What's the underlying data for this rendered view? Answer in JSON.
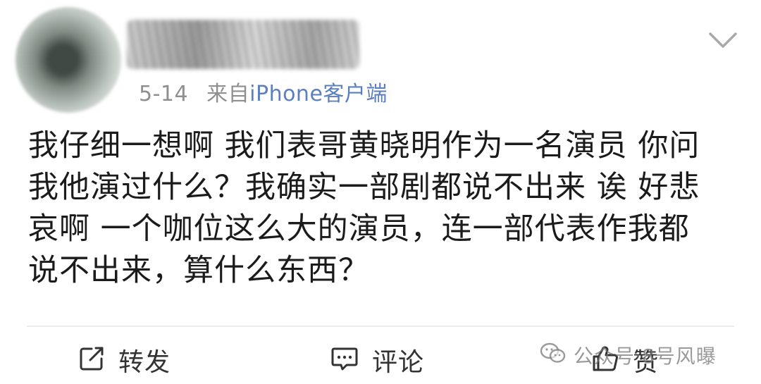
{
  "header": {
    "date": "5-14",
    "source_label": "来自",
    "source_app": "iPhone客户端"
  },
  "post": {
    "lines": [
      "我仔细一想啊 我们表哥黄晓明作为一名演员 你问",
      "我他演过什么？我确实一部剧都说不出来 诶 好悲",
      "哀啊 一个咖位这么大的演员，连一部代表作我都",
      "说不出来，算什么东西？"
    ]
  },
  "actions": {
    "repost_label": "转发",
    "comment_label": "评论",
    "like_label": "赞"
  },
  "watermark": {
    "text": "公众号·8号风曝"
  },
  "icons": {
    "expand": "chevron-down-icon",
    "repost": "share-icon",
    "comment": "comment-icon",
    "like": "thumbs-up-icon",
    "watermark": "wechat-icon"
  },
  "colors": {
    "text": "#1b1b1b",
    "meta": "#8f8f8f",
    "source_link": "#5b7fbf",
    "action": "#333333"
  }
}
